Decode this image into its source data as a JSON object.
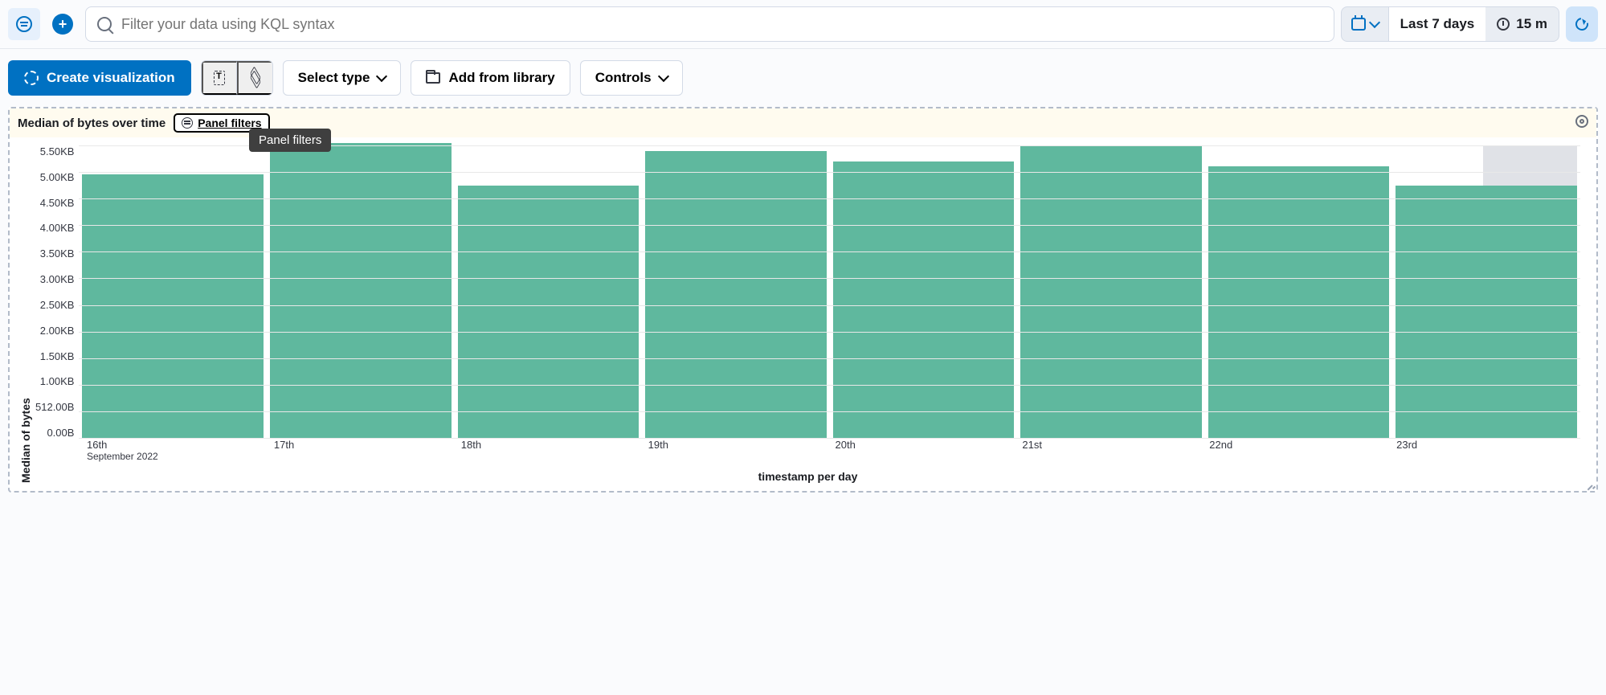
{
  "topbar": {
    "search_placeholder": "Filter your data using KQL syntax",
    "date_range": "Last 7 days",
    "refresh_interval": "15 m"
  },
  "toolbar": {
    "create_viz": "Create visualization",
    "select_type": "Select type",
    "add_from_library": "Add from library",
    "controls": "Controls"
  },
  "panel": {
    "title": "Median of bytes over time",
    "panel_filters": "Panel filters",
    "tooltip": "Panel filters"
  },
  "chart_data": {
    "type": "bar",
    "title": "Median of bytes over time",
    "xlabel": "timestamp per day",
    "ylabel": "Median of bytes",
    "y_ticks": [
      "5.50KB",
      "5.00KB",
      "4.50KB",
      "4.00KB",
      "3.50KB",
      "3.00KB",
      "2.50KB",
      "2.00KB",
      "1.50KB",
      "1.00KB",
      "512.00B",
      "0.00B"
    ],
    "ylim_kb": [
      0,
      5.5
    ],
    "x_subtitle": "September 2022",
    "categories": [
      "16th",
      "17th",
      "18th",
      "19th",
      "20th",
      "21st",
      "22nd",
      "23rd"
    ],
    "values_kb": [
      4.95,
      5.55,
      4.75,
      5.4,
      5.2,
      5.5,
      5.1,
      4.75
    ],
    "partial_last": true,
    "bar_color": "#5fb89e"
  }
}
